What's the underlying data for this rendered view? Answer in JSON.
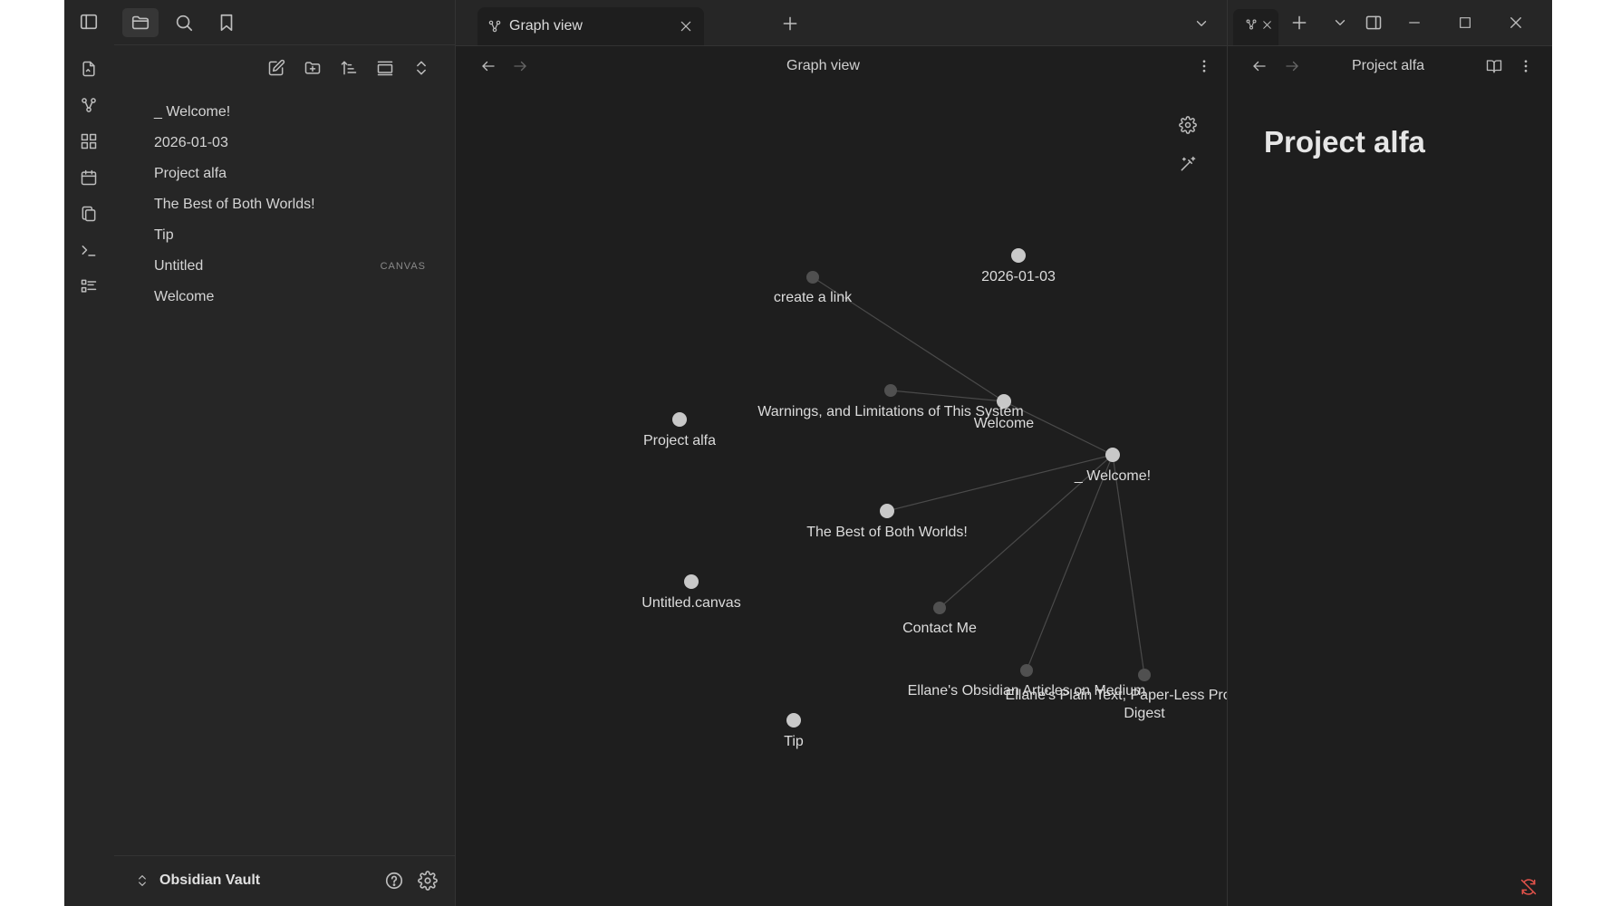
{
  "main": {
    "tab_label": "Graph view",
    "view_title": "Graph view"
  },
  "sidebar": {
    "files": [
      {
        "name": "_ Welcome!",
        "tag": ""
      },
      {
        "name": "2026-01-03",
        "tag": ""
      },
      {
        "name": "Project alfa",
        "tag": ""
      },
      {
        "name": "The Best of Both Worlds!",
        "tag": ""
      },
      {
        "name": "Tip",
        "tag": ""
      },
      {
        "name": "Untitled",
        "tag": "CANVAS"
      },
      {
        "name": "Welcome",
        "tag": ""
      }
    ],
    "vault_name": "Obsidian Vault"
  },
  "graph": {
    "nodes": [
      {
        "id": "n_create",
        "label": "create a link"
      },
      {
        "id": "n_date",
        "label": "2026-01-03"
      },
      {
        "id": "n_warn",
        "label": "Warnings, and Limitations of This System"
      },
      {
        "id": "n_welcome",
        "label": "Welcome"
      },
      {
        "id": "n_project",
        "label": "Project alfa"
      },
      {
        "id": "n_uwelcome",
        "label": "_ Welcome!"
      },
      {
        "id": "n_best",
        "label": "The Best of Both Worlds!"
      },
      {
        "id": "n_untitled",
        "label": "Untitled.canvas"
      },
      {
        "id": "n_contact",
        "label": "Contact Me"
      },
      {
        "id": "n_ellane1",
        "label": "Ellane's Obsidian Articles on Medium"
      },
      {
        "id": "n_ellane2_l1",
        "label": "Ellane's Plain Text, Paper-Less Productivity"
      },
      {
        "id": "n_ellane2_l2",
        "label": "Digest"
      },
      {
        "id": "n_tip",
        "label": "Tip"
      }
    ],
    "colors": {
      "resolved": "#c8c8c8",
      "unresolved": "#505050",
      "edge": "#4a4a4a"
    }
  },
  "right": {
    "view_title": "Project alfa",
    "note_title": "Project alfa"
  },
  "colors": {
    "alert": "#e5534b"
  }
}
